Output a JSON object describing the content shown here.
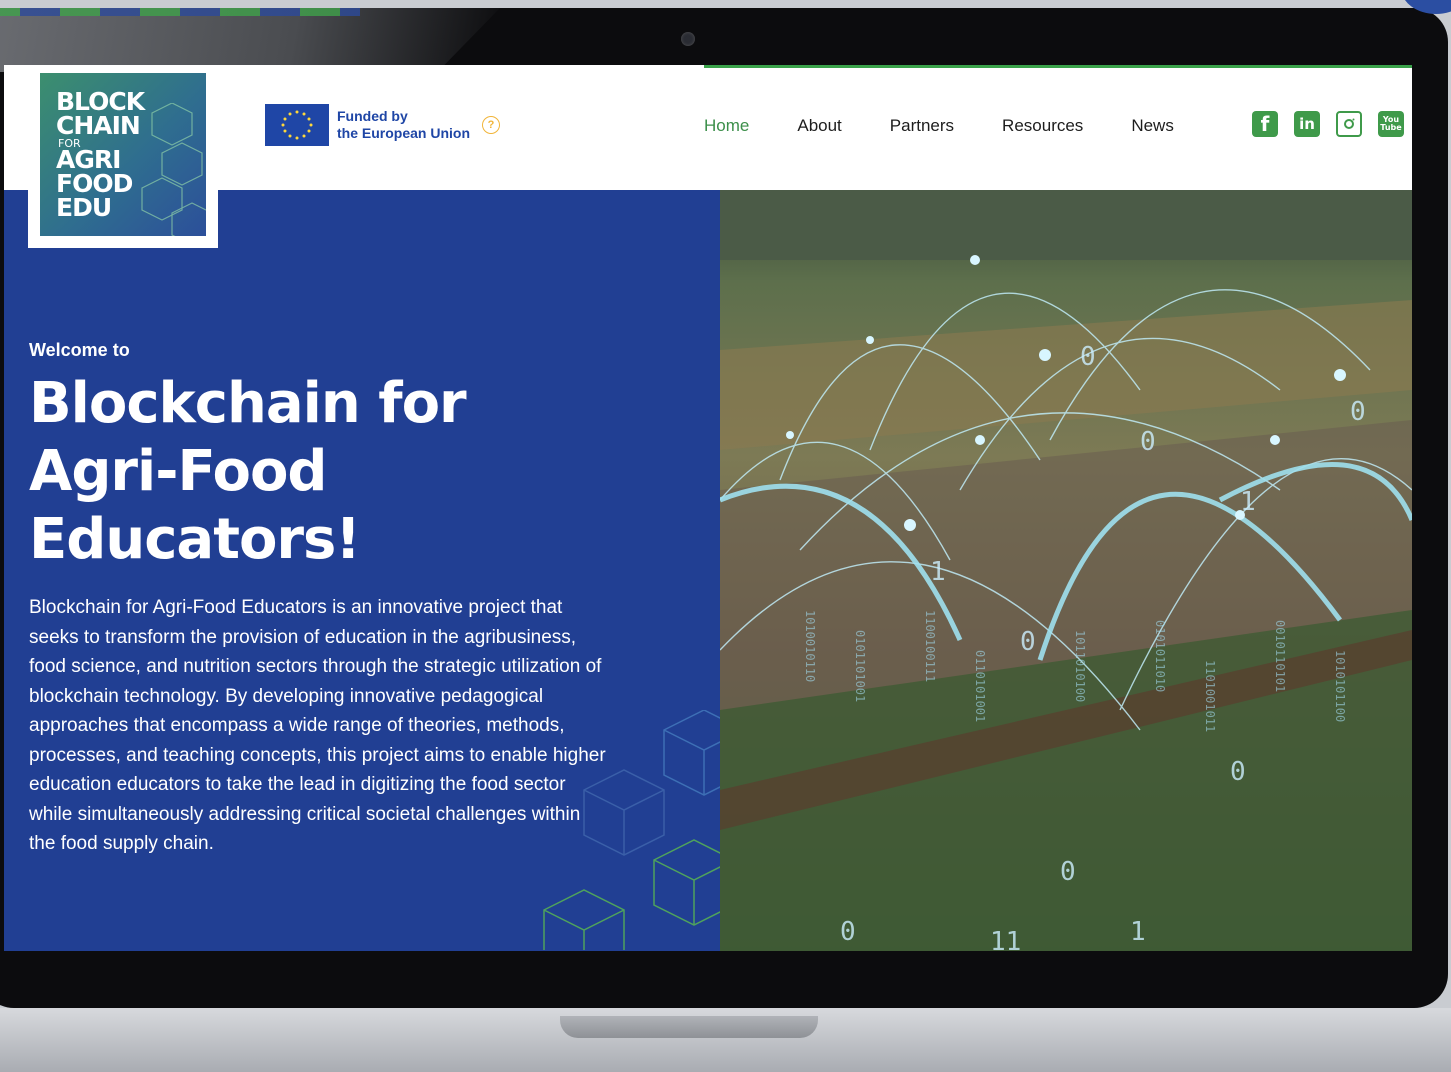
{
  "logo": {
    "lines": [
      "BLOCK",
      "CHAIN",
      "FOR",
      "AGRI",
      "FOOD",
      "EDU"
    ]
  },
  "eu_badge": {
    "line1": "Funded by",
    "line2": "the European Union",
    "help_glyph": "?"
  },
  "nav": {
    "items": [
      {
        "label": "Home",
        "active": true
      },
      {
        "label": "About",
        "active": false
      },
      {
        "label": "Partners",
        "active": false
      },
      {
        "label": "Resources",
        "active": false
      },
      {
        "label": "News",
        "active": false
      }
    ]
  },
  "social": {
    "icons": [
      "facebook-icon",
      "linkedin-icon",
      "instagram-icon",
      "youtube-icon"
    ],
    "facebook_glyph": "f",
    "linkedin_glyph": "in",
    "youtube_line1": "You",
    "youtube_line2": "Tube"
  },
  "hero": {
    "welcome": "Welcome to",
    "title": "Blockchain for Agri-Food Educators!",
    "description": "Blockchain for Agri-Food Educators is an innovative project that seeks to transform the provision of education in the agribusiness, food science, and nutrition sectors through the strategic utilization of blockchain technology. By developing innovative pedagogical approaches that encompass a wide range of theories, methods, processes, and teaching concepts, this project aims to enable higher education educators to take the lead in digitizing the food sector while simultaneously addressing critical societal challenges within the food supply chain."
  },
  "colors": {
    "brand_blue": "#213f93",
    "brand_green": "#3f9a4a",
    "eu_blue": "#1f46a6",
    "help_yellow": "#f1b53a"
  }
}
